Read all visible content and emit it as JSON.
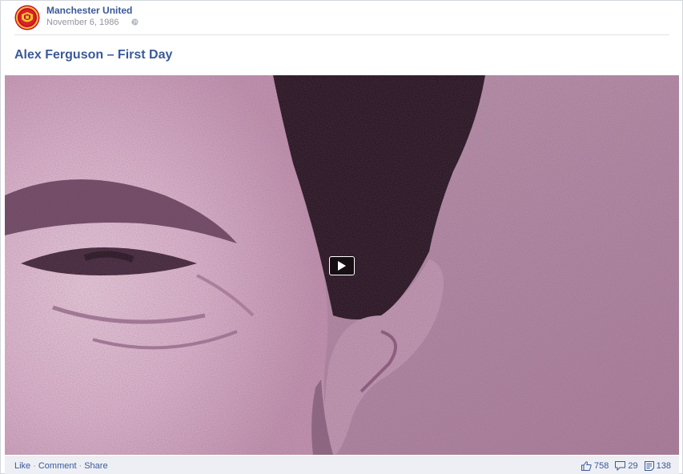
{
  "post": {
    "page_name": "Manchester United",
    "date": "November 6, 1986",
    "privacy_icon": "globe-icon",
    "title": "Alex Ferguson – First Day"
  },
  "video": {
    "play_icon": "play-icon"
  },
  "footer": {
    "like_label": "Like",
    "comment_label": "Comment",
    "share_label": "Share",
    "separator": "·",
    "likes_count": "758",
    "comments_count": "29",
    "shares_count": "138"
  },
  "colors": {
    "link_blue": "#3b5998",
    "meta_gray": "#90949c",
    "footer_bg": "#edeff4",
    "photo_tint": "#b995ad"
  }
}
